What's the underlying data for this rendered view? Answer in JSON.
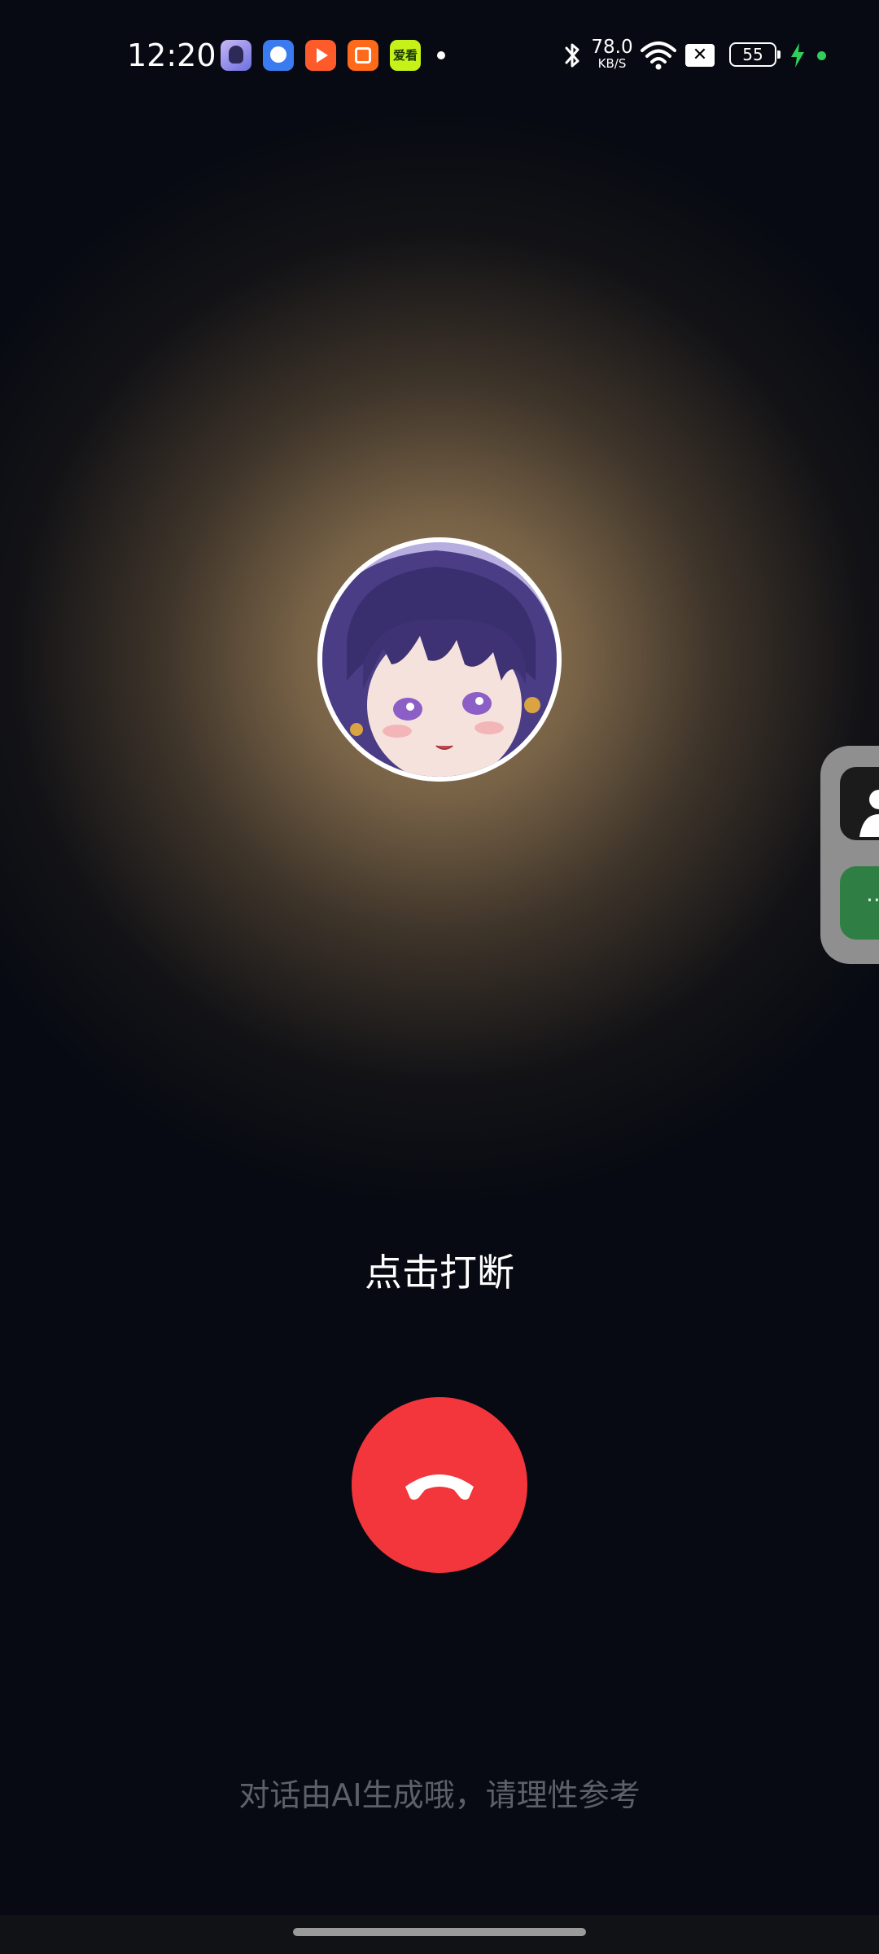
{
  "status_bar": {
    "time": "12:20",
    "net_speed_value": "78.0",
    "net_speed_unit": "KB/S",
    "battery_level": "55",
    "app_icon_5_text": "爱看",
    "sim_icon_glyph": "✕",
    "icons": [
      "app-icon",
      "app-icon",
      "app-icon",
      "app-icon",
      "app-icon",
      "bluetooth-icon",
      "wifi-icon",
      "sim-icon",
      "battery-icon",
      "charging-icon"
    ]
  },
  "call": {
    "avatar_icon": "character-avatar",
    "interrupt_text": "点击打断",
    "hangup_icon": "phone-hangup-icon",
    "hangup_color": "#f2363b"
  },
  "floating_panel": {
    "button_2_text": "··"
  },
  "footer": {
    "disclaimer": "对话由AI生成哦，请理性参考"
  },
  "colors": {
    "background": "#070a12",
    "glow": "#9e805a",
    "accent_green": "#2fcf5b"
  }
}
